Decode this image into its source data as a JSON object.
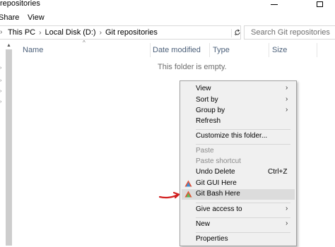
{
  "window": {
    "title": "repositories"
  },
  "ribbon": {
    "tabs": [
      {
        "label": "Share"
      },
      {
        "label": "View"
      }
    ]
  },
  "address": {
    "crumbs": [
      {
        "label": "This PC"
      },
      {
        "label": "Local Disk (D:)"
      },
      {
        "label": "Git repositories"
      }
    ]
  },
  "search": {
    "placeholder": "Search Git repositories"
  },
  "columns": [
    {
      "label": "Name"
    },
    {
      "label": "Date modified"
    },
    {
      "label": "Type"
    },
    {
      "label": "Size"
    }
  ],
  "content": {
    "empty_message": "This folder is empty."
  },
  "context_menu": {
    "items": [
      {
        "label": "View",
        "has_submenu": true
      },
      {
        "label": "Sort by",
        "has_submenu": true
      },
      {
        "label": "Group by",
        "has_submenu": true
      },
      {
        "label": "Refresh"
      },
      {
        "label": "Customize this folder..."
      },
      {
        "label": "Paste",
        "disabled": true
      },
      {
        "label": "Paste shortcut",
        "disabled": true
      },
      {
        "label": "Undo Delete",
        "shortcut": "Ctrl+Z"
      },
      {
        "label": "Git GUI Here",
        "icon": "git-icon"
      },
      {
        "label": "Git Bash Here",
        "icon": "git-icon",
        "highlighted": true
      },
      {
        "label": "Give access to",
        "has_submenu": true
      },
      {
        "label": "New",
        "has_submenu": true
      },
      {
        "label": "Properties"
      }
    ]
  },
  "colors": {
    "highlight": "#dcdcdc",
    "annotation_arrow": "#d21f1f",
    "header_text": "#4c607a"
  }
}
